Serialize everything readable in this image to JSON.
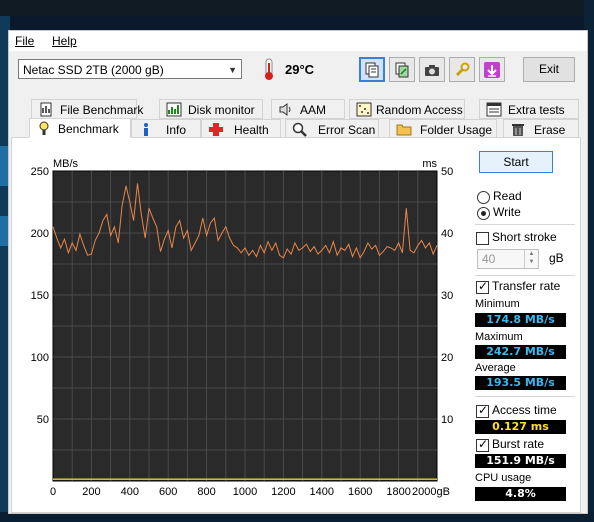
{
  "menu": {
    "file": "File",
    "help": "Help"
  },
  "toolbar": {
    "drive": "Netac SSD 2TB (2000 gB)",
    "temperature": "29°C",
    "exit_label": "Exit",
    "buttons": [
      "copy-text",
      "copy-image",
      "screenshot",
      "options",
      "save"
    ]
  },
  "tabs_top": [
    {
      "label": "File Benchmark",
      "icon": "file-benchmark-icon"
    },
    {
      "label": "Disk monitor",
      "icon": "disk-monitor-icon"
    },
    {
      "label": "AAM",
      "icon": "speaker-icon"
    },
    {
      "label": "Random Access",
      "icon": "random-access-icon"
    },
    {
      "label": "Extra tests",
      "icon": "extra-tests-icon"
    }
  ],
  "tabs_bottom": [
    {
      "label": "Benchmark",
      "icon": "benchmark-icon",
      "selected": true
    },
    {
      "label": "Info",
      "icon": "info-icon"
    },
    {
      "label": "Health",
      "icon": "health-cross-icon"
    },
    {
      "label": "Error Scan",
      "icon": "magnifier-icon"
    },
    {
      "label": "Folder Usage",
      "icon": "folder-icon"
    },
    {
      "label": "Erase",
      "icon": "trash-icon"
    }
  ],
  "controls": {
    "start_label": "Start",
    "read_label": "Read",
    "write_label": "Write",
    "mode_selected": "Write",
    "short_stroke_label": "Short stroke",
    "short_stroke_checked": false,
    "short_stroke_value": "40",
    "short_stroke_unit": "gB",
    "transfer_rate_label": "Transfer rate",
    "transfer_rate_checked": true,
    "minimum_label": "Minimum",
    "minimum_value": "174.8 MB/s",
    "maximum_label": "Maximum",
    "maximum_value": "242.7 MB/s",
    "average_label": "Average",
    "average_value": "193.5 MB/s",
    "access_time_label": "Access time",
    "access_time_checked": true,
    "access_time_value": "0.127 ms",
    "burst_rate_label": "Burst rate",
    "burst_rate_checked": true,
    "burst_rate_value": "151.9 MB/s",
    "cpu_usage_label": "CPU usage",
    "cpu_usage_value": "4.8%"
  },
  "chart_data": {
    "type": "line",
    "y_left_unit": "MB/s",
    "y_right_unit": "ms",
    "ylim_left": [
      0,
      250
    ],
    "ylim_right": [
      0,
      50
    ],
    "xlim": [
      0,
      2000
    ],
    "x_ticks": [
      "0",
      "200",
      "400",
      "600",
      "800",
      "1000",
      "1200",
      "1400",
      "1600",
      "1800",
      "2000gB"
    ],
    "y_left_ticks": [
      "250",
      "200",
      "150",
      "100",
      "50"
    ],
    "y_right_ticks": [
      "50",
      "40",
      "30",
      "20",
      "10"
    ],
    "grid": true,
    "colors": {
      "transfer": "#e8874a",
      "access": "#e4d622",
      "background": "#2a2a2a",
      "grid": "#4a4a4a"
    },
    "series": [
      {
        "x": [
          0,
          20,
          40,
          60,
          80,
          100,
          120,
          140,
          160,
          180,
          200,
          220,
          240,
          260,
          280,
          300,
          320,
          340,
          360,
          380,
          400,
          420,
          440,
          460,
          480,
          500,
          520,
          540,
          560,
          580,
          600,
          620,
          640,
          660,
          680,
          700,
          720,
          740,
          760,
          780,
          800,
          820,
          840,
          860,
          880,
          900,
          920,
          940,
          960,
          980,
          1000,
          1020,
          1040,
          1060,
          1080,
          1100,
          1120,
          1140,
          1160,
          1180,
          1200,
          1220,
          1240,
          1260,
          1280,
          1300,
          1320,
          1340,
          1360,
          1380,
          1400,
          1420,
          1440,
          1460,
          1480,
          1500,
          1520,
          1540,
          1560,
          1580,
          1600,
          1620,
          1640,
          1660,
          1680,
          1700,
          1720,
          1740,
          1760,
          1780,
          1800,
          1820,
          1840,
          1860,
          1880,
          1900,
          1920,
          1940,
          1960,
          1980,
          2000
        ],
        "values": [
          205,
          196,
          188,
          195,
          184,
          192,
          186,
          199,
          190,
          182,
          183,
          194,
          200,
          210,
          215,
          198,
          205,
          192,
          222,
          238,
          225,
          210,
          240,
          215,
          196,
          220,
          212,
          205,
          185,
          195,
          202,
          188,
          205,
          210,
          196,
          202,
          186,
          192,
          198,
          212,
          198,
          208,
          212,
          194,
          200,
          205,
          196,
          190,
          188,
          184,
          188,
          182,
          186,
          181,
          190,
          184,
          193,
          186,
          192,
          182,
          180,
          187,
          183,
          192,
          186,
          188,
          191,
          185,
          189,
          183,
          186,
          190,
          184,
          193,
          182,
          188,
          186,
          191,
          181,
          188,
          180,
          185,
          192,
          187,
          190,
          182,
          185,
          189,
          188,
          186,
          192,
          184,
          220,
          186,
          184,
          190,
          194,
          188,
          192,
          183,
          190
        ]
      }
    ],
    "access_time_ms": 0.127
  }
}
